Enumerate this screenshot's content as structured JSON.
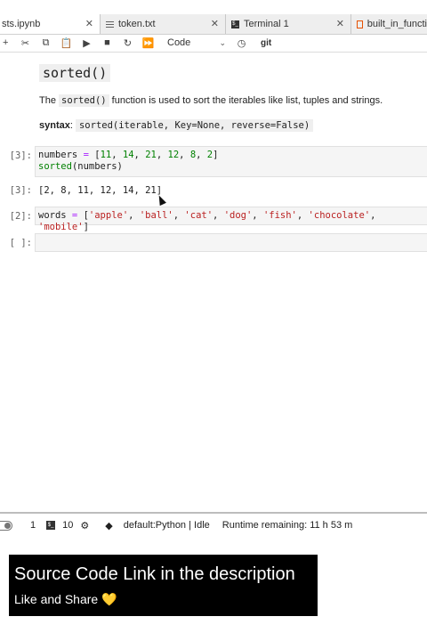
{
  "tabs": [
    {
      "label": "sts.ipynb",
      "icon": "notebook-icon"
    },
    {
      "label": "token.txt",
      "icon": "text-file-icon"
    },
    {
      "label": "Terminal 1",
      "icon": "terminal-icon"
    },
    {
      "label": "built_in_functi",
      "icon": "json-icon"
    }
  ],
  "toolbar": {
    "cell_type": "Code",
    "git_label": "git"
  },
  "notebook": {
    "heading": "sorted()",
    "para_pre": "The",
    "para_code": "sorted()",
    "para_post": "function is used to sort the iterables like list, tuples and strings.",
    "syntax_label": "syntax",
    "syntax_colon": ":",
    "syntax_code": "sorted(iterable, Key=None, reverse=False)",
    "cells": [
      {
        "prompt": "[3]:",
        "line1_var": "numbers",
        "line1_op": " = ",
        "line1_open": "[",
        "nums": [
          "11",
          "14",
          "21",
          "12",
          "8",
          "2"
        ],
        "line1_close": "]",
        "line2": "sorted",
        "line2_args": "(numbers)"
      },
      {
        "out_prompt": "[3]:",
        "output": "[2, 8, 11, 12, 14, 21]"
      },
      {
        "prompt": "[2]:",
        "var": "words",
        "op": " = ",
        "strs": [
          "'apple'",
          "'ball'",
          "'cat'",
          "'dog'",
          "'fish'",
          "'chocolate'",
          "'mobile'"
        ]
      },
      {
        "prompt": "[ ]:"
      }
    ]
  },
  "statusbar": {
    "count1": "1",
    "count2": "10",
    "kernel": "default:Python | Idle",
    "runtime": "Runtime remaining: 11 h 53 m"
  },
  "caption": {
    "title": "Source Code Link in the description",
    "subtitle": "Like and Share 💛"
  }
}
